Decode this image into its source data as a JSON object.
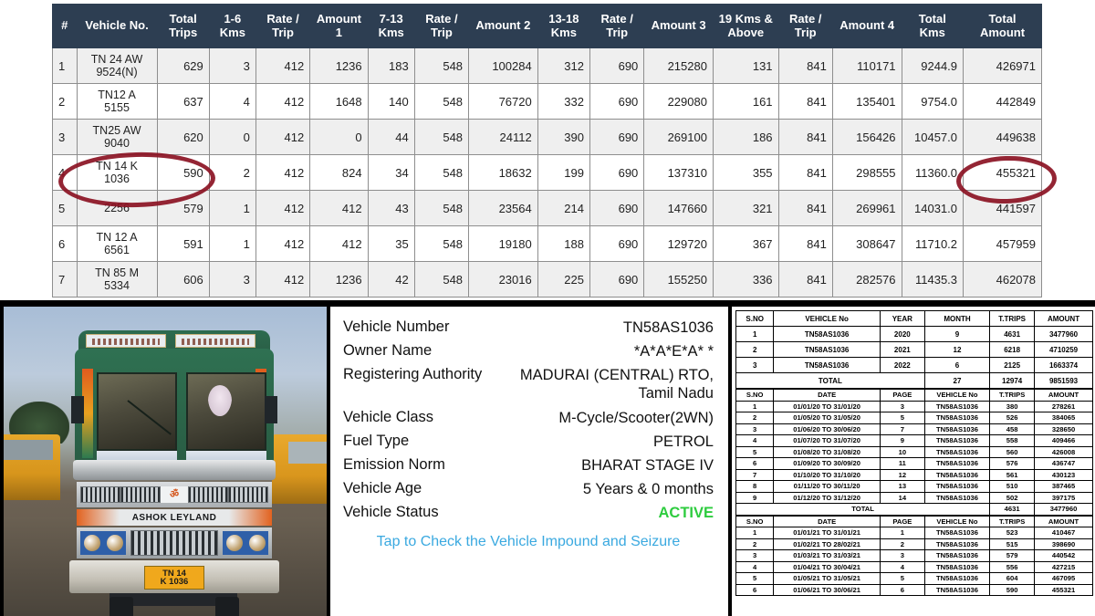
{
  "trip_table": {
    "headers": [
      "#",
      "Vehicle No.",
      "Total Trips",
      "1-6 Kms",
      "Rate / Trip",
      "Amount 1",
      "7-13 Kms",
      "Rate / Trip",
      "Amount 2",
      "13-18 Kms",
      "Rate / Trip",
      "Amount 3",
      "19 Kms & Above",
      "Rate / Trip",
      "Amount 4",
      "Total Kms",
      "Total Amount"
    ],
    "header_bg": "#2d3e52",
    "rows": [
      {
        "idx": "1",
        "vehicle_no": "TN 24 AW 9524(N)",
        "total_trips": "629",
        "k1_6": "3",
        "rate1": "412",
        "amount1": "1236",
        "k7_13": "183",
        "rate2": "548",
        "amount2": "100284",
        "k13_18": "312",
        "rate3": "690",
        "amount3": "215280",
        "k19": "131",
        "rate4": "841",
        "amount4": "110171",
        "total_kms": "9244.9",
        "total_amount": "426971"
      },
      {
        "idx": "2",
        "vehicle_no": "TN12 A 5155",
        "total_trips": "637",
        "k1_6": "4",
        "rate1": "412",
        "amount1": "1648",
        "k7_13": "140",
        "rate2": "548",
        "amount2": "76720",
        "k13_18": "332",
        "rate3": "690",
        "amount3": "229080",
        "k19": "161",
        "rate4": "841",
        "amount4": "135401",
        "total_kms": "9754.0",
        "total_amount": "442849"
      },
      {
        "idx": "3",
        "vehicle_no": "TN25 AW 9040",
        "total_trips": "620",
        "k1_6": "0",
        "rate1": "412",
        "amount1": "0",
        "k7_13": "44",
        "rate2": "548",
        "amount2": "24112",
        "k13_18": "390",
        "rate3": "690",
        "amount3": "269100",
        "k19": "186",
        "rate4": "841",
        "amount4": "156426",
        "total_kms": "10457.0",
        "total_amount": "449638"
      },
      {
        "idx": "4",
        "vehicle_no": "TN 14 K 1036",
        "total_trips": "590",
        "k1_6": "2",
        "rate1": "412",
        "amount1": "824",
        "k7_13": "34",
        "rate2": "548",
        "amount2": "18632",
        "k13_18": "199",
        "rate3": "690",
        "amount3": "137310",
        "k19": "355",
        "rate4": "841",
        "amount4": "298555",
        "total_kms": "11360.0",
        "total_amount": "455321"
      },
      {
        "idx": "5",
        "vehicle_no": "2256",
        "total_trips": "579",
        "k1_6": "1",
        "rate1": "412",
        "amount1": "412",
        "k7_13": "43",
        "rate2": "548",
        "amount2": "23564",
        "k13_18": "214",
        "rate3": "690",
        "amount3": "147660",
        "k19": "321",
        "rate4": "841",
        "amount4": "269961",
        "total_kms": "14031.0",
        "total_amount": "441597"
      },
      {
        "idx": "6",
        "vehicle_no": "TN 12 A 6561",
        "total_trips": "591",
        "k1_6": "1",
        "rate1": "412",
        "amount1": "412",
        "k7_13": "35",
        "rate2": "548",
        "amount2": "19180",
        "k13_18": "188",
        "rate3": "690",
        "amount3": "129720",
        "k19": "367",
        "rate4": "841",
        "amount4": "308647",
        "total_kms": "11710.2",
        "total_amount": "457959"
      },
      {
        "idx": "7",
        "vehicle_no": "TN 85 M 5334",
        "total_trips": "606",
        "k1_6": "3",
        "rate1": "412",
        "amount1": "1236",
        "k7_13": "42",
        "rate2": "548",
        "amount2": "23016",
        "k13_18": "225",
        "rate3": "690",
        "amount3": "155250",
        "k19": "336",
        "rate4": "841",
        "amount4": "282576",
        "total_kms": "11435.3",
        "total_amount": "462078"
      }
    ],
    "annotations": {
      "color": "#8b1223",
      "circled_row_vehicle": "TN 14 K 1036",
      "circled_total_amount": "455321"
    }
  },
  "photo": {
    "truck_make": "ASHOK LEYLAND",
    "plate_line1": "TN 14",
    "plate_line2": "K 1036"
  },
  "vehicle_details": {
    "rows": [
      {
        "label": "Vehicle Number",
        "value": "TN58AS1036"
      },
      {
        "label": "Owner Name",
        "value": "*A*A*E*A*  *"
      },
      {
        "label": "Registering Authority",
        "value": "MADURAI (CENTRAL) RTO, Tamil Nadu"
      },
      {
        "label": "Vehicle Class",
        "value": "M-Cycle/Scooter(2WN)"
      },
      {
        "label": "Fuel Type",
        "value": "PETROL"
      },
      {
        "label": "Emission Norm",
        "value": "BHARAT STAGE IV"
      },
      {
        "label": "Vehicle Age",
        "value": "5 Years  & 0 months"
      },
      {
        "label": "Vehicle Status",
        "value": "ACTIVE"
      }
    ],
    "status_color": "#2ecc3f",
    "link_text": "Tap to Check the Vehicle Impound and Seizure",
    "link_color": "#3aa9e0"
  },
  "report": {
    "summary": {
      "headers": [
        "S.NO",
        "VEHICLE No",
        "YEAR",
        "MONTH",
        "T.TRIPS",
        "AMOUNT"
      ],
      "rows": [
        [
          "1",
          "TN58AS1036",
          "2020",
          "9",
          "4631",
          "3477960"
        ],
        [
          "2",
          "TN58AS1036",
          "2021",
          "12",
          "6218",
          "4710259"
        ],
        [
          "3",
          "TN58AS1036",
          "2022",
          "6",
          "2125",
          "1663374"
        ]
      ],
      "total_label": "TOTAL",
      "total": [
        "27",
        "12974",
        "9851593"
      ]
    },
    "detail_2020": {
      "headers": [
        "S.NO",
        "DATE",
        "PAGE",
        "VEHICLE No",
        "T.TRIPS",
        "AMOUNT"
      ],
      "rows": [
        [
          "1",
          "01/01/20 TO 31/01/20",
          "3",
          "TN58AS1036",
          "380",
          "278261"
        ],
        [
          "2",
          "01/05/20 TO 31/05/20",
          "5",
          "TN58AS1036",
          "526",
          "384065"
        ],
        [
          "3",
          "01/06/20 TO 30/06/20",
          "7",
          "TN58AS1036",
          "458",
          "328650"
        ],
        [
          "4",
          "01/07/20 TO 31/07/20",
          "9",
          "TN58AS1036",
          "558",
          "409466"
        ],
        [
          "5",
          "01/08/20 TO 31/08/20",
          "10",
          "TN58AS1036",
          "560",
          "426008"
        ],
        [
          "6",
          "01/09/20 TO 30/09/20",
          "11",
          "TN58AS1036",
          "576",
          "436747"
        ],
        [
          "7",
          "01/10/20 TO 31/10/20",
          "12",
          "TN58AS1036",
          "561",
          "430123"
        ],
        [
          "8",
          "01/11/20 TO 30/11/20",
          "13",
          "TN58AS1036",
          "510",
          "387465"
        ],
        [
          "9",
          "01/12/20 TO 31/12/20",
          "14",
          "TN58AS1036",
          "502",
          "397175"
        ]
      ],
      "total_label": "TOTAL",
      "total": [
        "4631",
        "3477960"
      ]
    },
    "detail_2021": {
      "headers": [
        "S.NO",
        "DATE",
        "PAGE",
        "VEHICLE No",
        "T.TRIPS",
        "AMOUNT"
      ],
      "rows": [
        [
          "1",
          "01/01/21 TO 31/01/21",
          "1",
          "TN58AS1036",
          "523",
          "410467"
        ],
        [
          "2",
          "01/02/21 TO 28/02/21",
          "2",
          "TN58AS1036",
          "515",
          "398690"
        ],
        [
          "3",
          "01/03/21 TO 31/03/21",
          "3",
          "TN58AS1036",
          "579",
          "440542"
        ],
        [
          "4",
          "01/04/21 TO 30/04/21",
          "4",
          "TN58AS1036",
          "556",
          "427215"
        ],
        [
          "5",
          "01/05/21 TO 31/05/21",
          "5",
          "TN58AS1036",
          "604",
          "467095"
        ],
        [
          "6",
          "01/06/21 TO 30/06/21",
          "6",
          "TN58AS1036",
          "590",
          "455321"
        ]
      ]
    }
  }
}
